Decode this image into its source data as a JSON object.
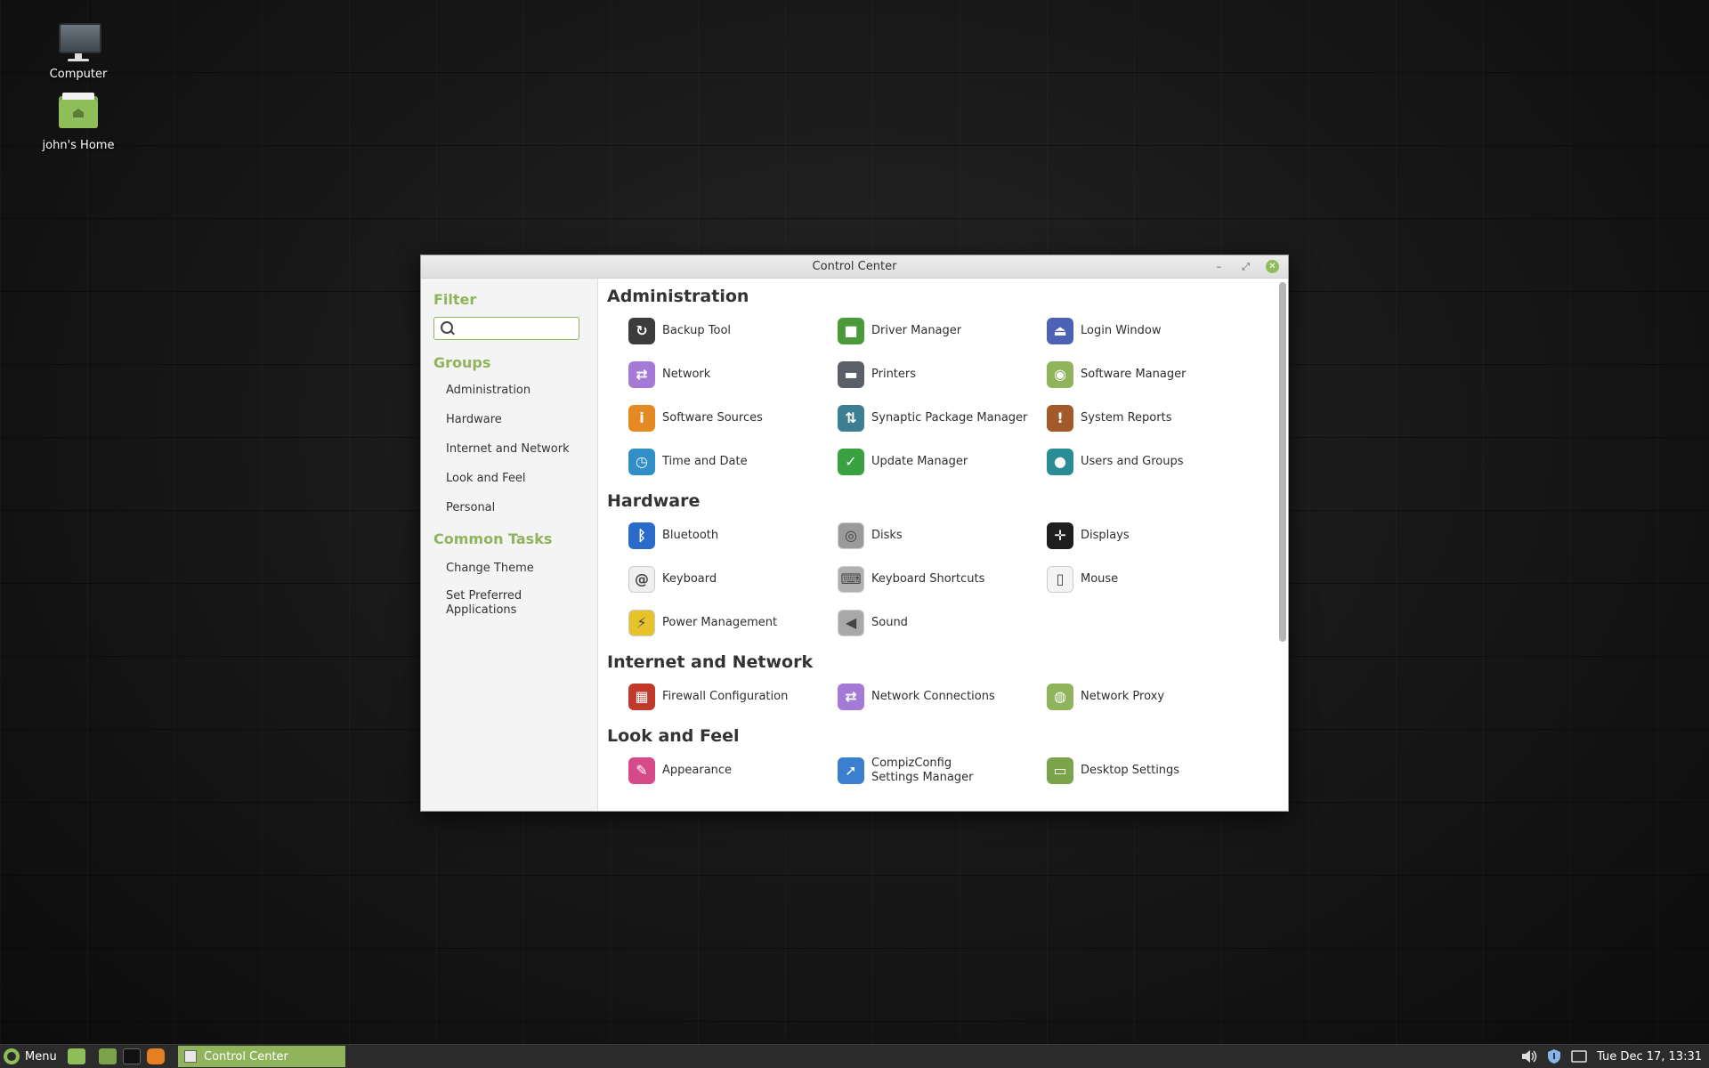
{
  "desktop": {
    "icons": [
      {
        "label": "Computer",
        "icon": "computer-icon"
      },
      {
        "label": "john's Home",
        "icon": "home-folder-icon"
      }
    ]
  },
  "window": {
    "title": "Control Center",
    "buttons": {
      "minimize": "–",
      "maximize": "⤢",
      "close": "✕"
    }
  },
  "sidebar": {
    "filter_heading": "Filter",
    "search": {
      "value": "",
      "placeholder": ""
    },
    "groups_heading": "Groups",
    "groups": [
      "Administration",
      "Hardware",
      "Internet and Network",
      "Look and Feel",
      "Personal"
    ],
    "tasks_heading": "Common Tasks",
    "tasks": [
      "Change Theme",
      "Set Preferred Applications"
    ]
  },
  "sections": [
    {
      "title": "Administration",
      "items": [
        {
          "label": "Backup Tool",
          "icon": "backup-icon",
          "color": "#3c3c3c",
          "glyph": "↻"
        },
        {
          "label": "Driver Manager",
          "icon": "chip-icon",
          "color": "#4a9a3a",
          "glyph": "■"
        },
        {
          "label": "Login Window",
          "icon": "login-icon",
          "color": "#4b62b5",
          "glyph": "⏏"
        },
        {
          "label": "Network",
          "icon": "network-icon",
          "color": "#a57ad6",
          "glyph": "⇄"
        },
        {
          "label": "Printers",
          "icon": "printer-icon",
          "color": "#5b6068",
          "glyph": "▬"
        },
        {
          "label": "Software Manager",
          "icon": "software-manager-icon",
          "color": "#8fb45c",
          "glyph": "◉"
        },
        {
          "label": "Software Sources",
          "icon": "info-icon",
          "color": "#e58a23",
          "glyph": "i"
        },
        {
          "label": "Synaptic Package Manager",
          "icon": "package-icon",
          "color": "#3c7f93",
          "glyph": "⇅"
        },
        {
          "label": "System Reports",
          "icon": "alert-icon",
          "color": "#a35a2a",
          "glyph": "!"
        },
        {
          "label": "Time and Date",
          "icon": "clock-icon",
          "color": "#2f8fc6",
          "glyph": "◷"
        },
        {
          "label": "Update Manager",
          "icon": "shield-icon",
          "color": "#3aa140",
          "glyph": "✓"
        },
        {
          "label": "Users and Groups",
          "icon": "user-icon",
          "color": "#2a8c95",
          "glyph": "●"
        }
      ]
    },
    {
      "title": "Hardware",
      "items": [
        {
          "label": "Bluetooth",
          "icon": "bluetooth-icon",
          "color": "#2a6bc9",
          "glyph": "ᛒ"
        },
        {
          "label": "Disks",
          "icon": "disk-icon",
          "color": "#9a9a9a",
          "glyph": "◎"
        },
        {
          "label": "Displays",
          "icon": "display-arrows-icon",
          "color": "#1e1e1e",
          "glyph": "✛"
        },
        {
          "label": "Keyboard",
          "icon": "keyboard-icon",
          "color": "#f0f0f0",
          "glyph": "@"
        },
        {
          "label": "Keyboard Shortcuts",
          "icon": "keyboard-shortcuts-icon",
          "color": "#b0b0b0",
          "glyph": "⌨"
        },
        {
          "label": "Mouse",
          "icon": "mouse-icon",
          "color": "#f4f4f4",
          "glyph": "▯"
        },
        {
          "label": "Power Management",
          "icon": "power-icon",
          "color": "#e6c32a",
          "glyph": "⚡"
        },
        {
          "label": "Sound",
          "icon": "speaker-icon",
          "color": "#a8a8a8",
          "glyph": "◀"
        }
      ]
    },
    {
      "title": "Internet and Network",
      "items": [
        {
          "label": "Firewall Configuration",
          "icon": "firewall-icon",
          "color": "#c0392b",
          "glyph": "▦"
        },
        {
          "label": "Network Connections",
          "icon": "network-connections-icon",
          "color": "#a57ad6",
          "glyph": "⇄"
        },
        {
          "label": "Network Proxy",
          "icon": "proxy-folder-icon",
          "color": "#8fb45c",
          "glyph": "◍"
        }
      ]
    },
    {
      "title": "Look and Feel",
      "items": [
        {
          "label": "Appearance",
          "icon": "appearance-icon",
          "color": "#d64a8a",
          "glyph": "✎"
        },
        {
          "label": "CompizConfig Settings Manager",
          "icon": "compiz-icon",
          "color": "#3a7fd0",
          "glyph": "➚"
        },
        {
          "label": "Desktop Settings",
          "icon": "desktop-settings-icon",
          "color": "#7aa34a",
          "glyph": "▭"
        }
      ]
    }
  ],
  "taskbar": {
    "menu_label": "Menu",
    "task_label": "Control Center",
    "clock": "Tue Dec 17, 13:31"
  }
}
